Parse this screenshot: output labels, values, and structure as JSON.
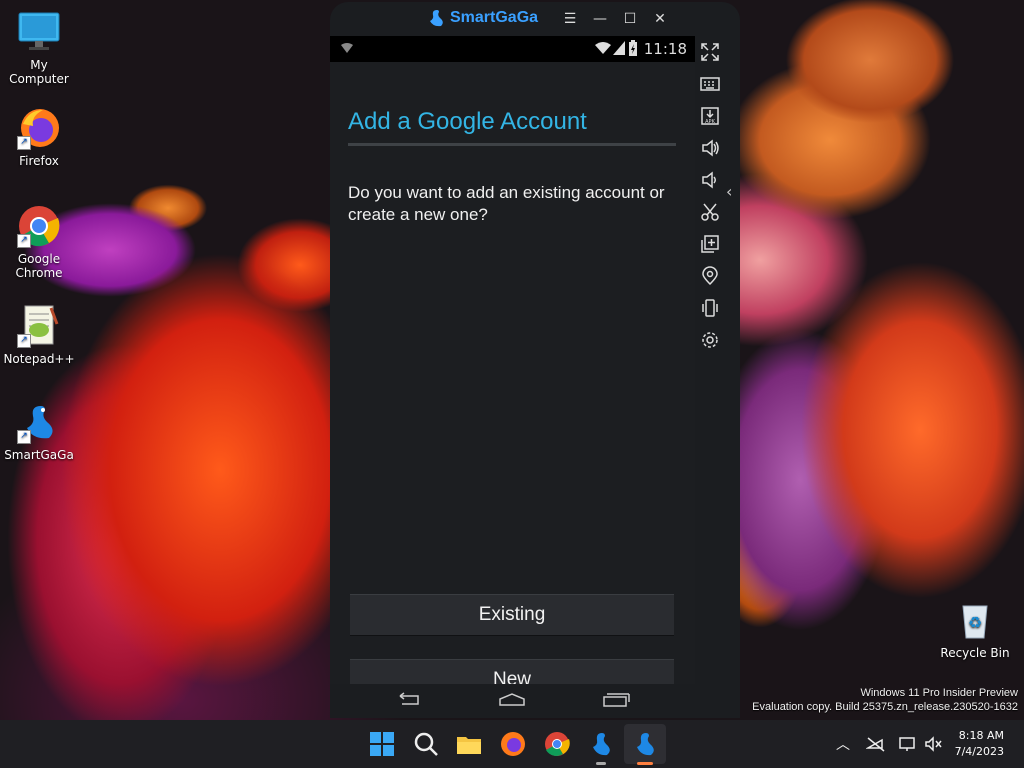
{
  "desktop": {
    "icons": [
      {
        "label": "My Computer"
      },
      {
        "label": "Firefox"
      },
      {
        "label": "Google Chrome"
      },
      {
        "label": "Notepad++"
      },
      {
        "label": "SmartGaGa"
      },
      {
        "label": "Recycle Bin"
      }
    ],
    "watermark_line1": "Windows 11 Pro Insider Preview",
    "watermark_line2": "Evaluation copy. Build 25375.zn_release.230520-1632"
  },
  "emulator": {
    "brand": "SmartGaGa",
    "status_time": "11:18",
    "screen": {
      "title": "Add a Google Account",
      "question": "Do you want to add an existing account or create a new one?",
      "existing_button": "Existing",
      "new_button": "New"
    },
    "sidebar_icons": [
      "fullscreen-icon",
      "keyboard-icon",
      "install-apk-icon",
      "volume-up-icon",
      "volume-down-icon",
      "screenshot-icon",
      "multi-instance-icon",
      "location-icon",
      "shake-icon",
      "settings-icon"
    ]
  },
  "taskbar": {
    "time": "8:18 AM",
    "date": "7/4/2023"
  },
  "colors": {
    "accent": "#33b5e5",
    "brand_blue": "#3aa0ff"
  }
}
